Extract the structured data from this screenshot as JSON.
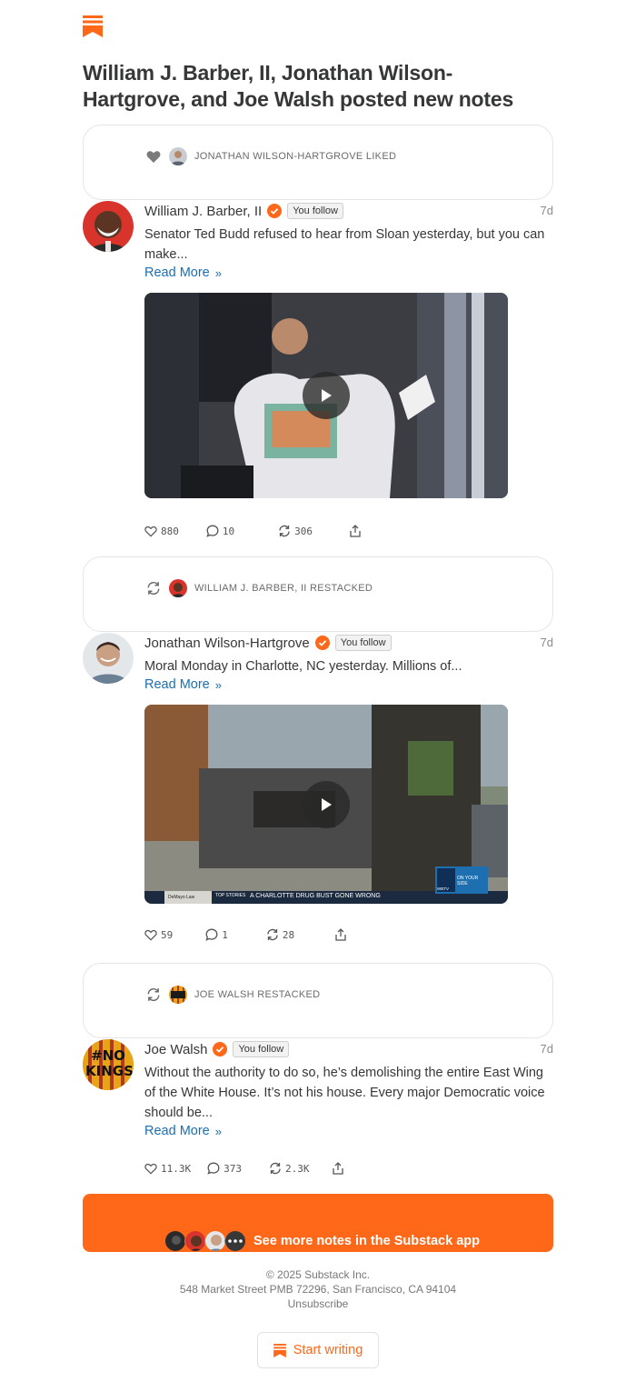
{
  "headline": "William J. Barber, II, Jonathan Wilson-Hartgrove, and Joe Walsh posted new notes",
  "colors": {
    "brand": "#ff6719",
    "link": "#1a6fb3",
    "text": "#363737",
    "verified": "#ff6719"
  },
  "notes": [
    {
      "context": {
        "icon": "heart-icon",
        "text": "JONATHAN WILSON-HARTGROVE LIKED"
      },
      "author": "William J. Barber, II",
      "follow_label": "You follow",
      "time": "7d",
      "text": "Senator Ted Budd refused to hear from Sloan yesterday, but you can make...",
      "read_more": "Read More",
      "has_video": true,
      "actions": {
        "likes": "880",
        "comments": "10",
        "restacks": "306"
      }
    },
    {
      "context": {
        "icon": "restack-icon",
        "text": "WILLIAM J. BARBER, II RESTACKED"
      },
      "author": "Jonathan Wilson-Hartgrove",
      "follow_label": "You follow",
      "time": "7d",
      "text": "Moral Monday in Charlotte, NC yesterday. Millions of...",
      "read_more": "Read More",
      "has_video": true,
      "video_captions": {
        "ticker": "A CHARLOTTE DRUG BUST GONE WRONG",
        "top": "TOP STORIES",
        "sponsor": "DeMayo Law",
        "channel": "WBTV",
        "tagline": "ON YOUR SIDE"
      },
      "actions": {
        "likes": "59",
        "comments": "1",
        "restacks": "28"
      }
    },
    {
      "context": {
        "icon": "restack-icon",
        "text": "JOE WALSH RESTACKED"
      },
      "author": "Joe Walsh",
      "follow_label": "You follow",
      "time": "7d",
      "text": "Without the authority to do so, he’s demolishing the entire East Wing of the White House. It’s not his house. Every major Democratic voice should be...",
      "read_more": "Read More",
      "has_video": false,
      "avatar_text": "#NO KINGS",
      "actions": {
        "likes": "11.3K",
        "comments": "373",
        "restacks": "2.3K"
      }
    }
  ],
  "cta": {
    "label": "See more notes in the Substack app"
  },
  "footer": {
    "copyright": "© 2025 Substack Inc.",
    "address": "548 Market Street PMB 72296, San Francisco, CA 94104",
    "unsubscribe": "Unsubscribe"
  },
  "start_writing": "Start writing"
}
